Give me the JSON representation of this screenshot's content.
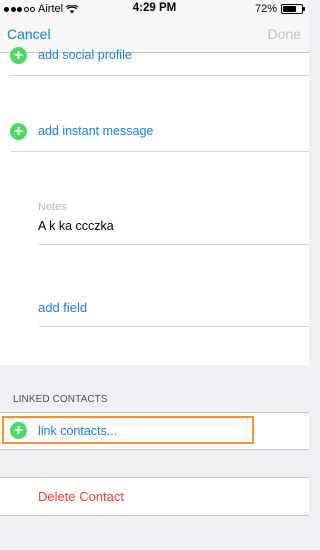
{
  "status_bar": {
    "carrier": "Airtel",
    "time": "4:29 PM",
    "battery": "72%",
    "battery_level": 0.72
  },
  "nav": {
    "cancel": "Cancel",
    "done": "Done"
  },
  "rows": {
    "social_profile": "add social profile",
    "instant_message": "add instant message"
  },
  "notes": {
    "label": "Notes",
    "value": "A k ka ccczka"
  },
  "add_field": "add field",
  "linked_contacts": {
    "header": "LINKED CONTACTS",
    "link_label": "link contacts..."
  },
  "delete_contact": "Delete Contact",
  "colors": {
    "accent": "#1a7dd8",
    "add_green": "#4cd964",
    "destructive": "#ff3b30",
    "highlight": "#f5943b"
  },
  "icons": [
    "signal-dots-icon",
    "wifi-icon",
    "battery-icon",
    "plus-circle-icon"
  ]
}
